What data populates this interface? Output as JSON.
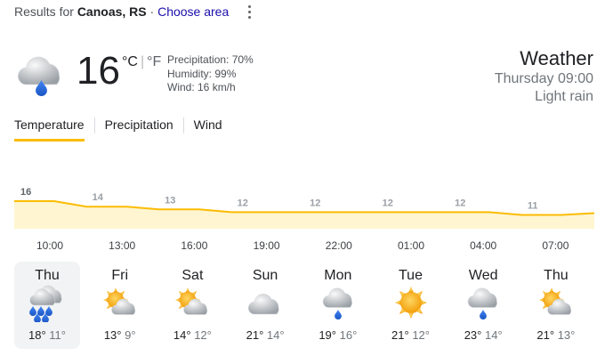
{
  "header": {
    "results_prefix": "Results for",
    "location": "Canoas, RS",
    "separator": "·",
    "choose_area": "Choose area"
  },
  "current": {
    "temp": "16",
    "unit_c": "°C",
    "unit_sep": "|",
    "unit_f": "°F",
    "precipitation": "Precipitation: 70%",
    "humidity": "Humidity: 99%",
    "wind": "Wind: 16 km/h",
    "icon": "cloud-rain-icon"
  },
  "summary": {
    "title": "Weather",
    "datetime": "Thursday 09:00",
    "condition": "Light rain"
  },
  "tabs": [
    "Temperature",
    "Precipitation",
    "Wind"
  ],
  "chart_data": {
    "type": "area",
    "x": [
      "10:00",
      "13:00",
      "16:00",
      "19:00",
      "22:00",
      "01:00",
      "04:00",
      "07:00"
    ],
    "values": [
      16,
      14,
      13,
      12,
      12,
      12,
      12,
      11
    ],
    "ylabel": "",
    "xlabel": ""
  },
  "days": [
    {
      "name": "Thu",
      "hi": "18°",
      "lo": "11°",
      "icon": "heavy-rain-icon"
    },
    {
      "name": "Fri",
      "hi": "13°",
      "lo": "9°",
      "icon": "partly-cloudy-icon"
    },
    {
      "name": "Sat",
      "hi": "14°",
      "lo": "12°",
      "icon": "partly-cloudy-icon"
    },
    {
      "name": "Sun",
      "hi": "21°",
      "lo": "14°",
      "icon": "cloudy-icon"
    },
    {
      "name": "Mon",
      "hi": "19°",
      "lo": "16°",
      "icon": "cloud-rain-icon"
    },
    {
      "name": "Tue",
      "hi": "21°",
      "lo": "12°",
      "icon": "sunny-icon"
    },
    {
      "name": "Wed",
      "hi": "23°",
      "lo": "14°",
      "icon": "cloud-rain-icon"
    },
    {
      "name": "Thu",
      "hi": "21°",
      "lo": "13°",
      "icon": "partly-cloudy-icon"
    }
  ],
  "colors": {
    "accent": "#fbbc04",
    "area_fill": "#fff5d1",
    "link": "#1a0dab",
    "rain": "#1967d2",
    "sun": "#f9ab00"
  }
}
